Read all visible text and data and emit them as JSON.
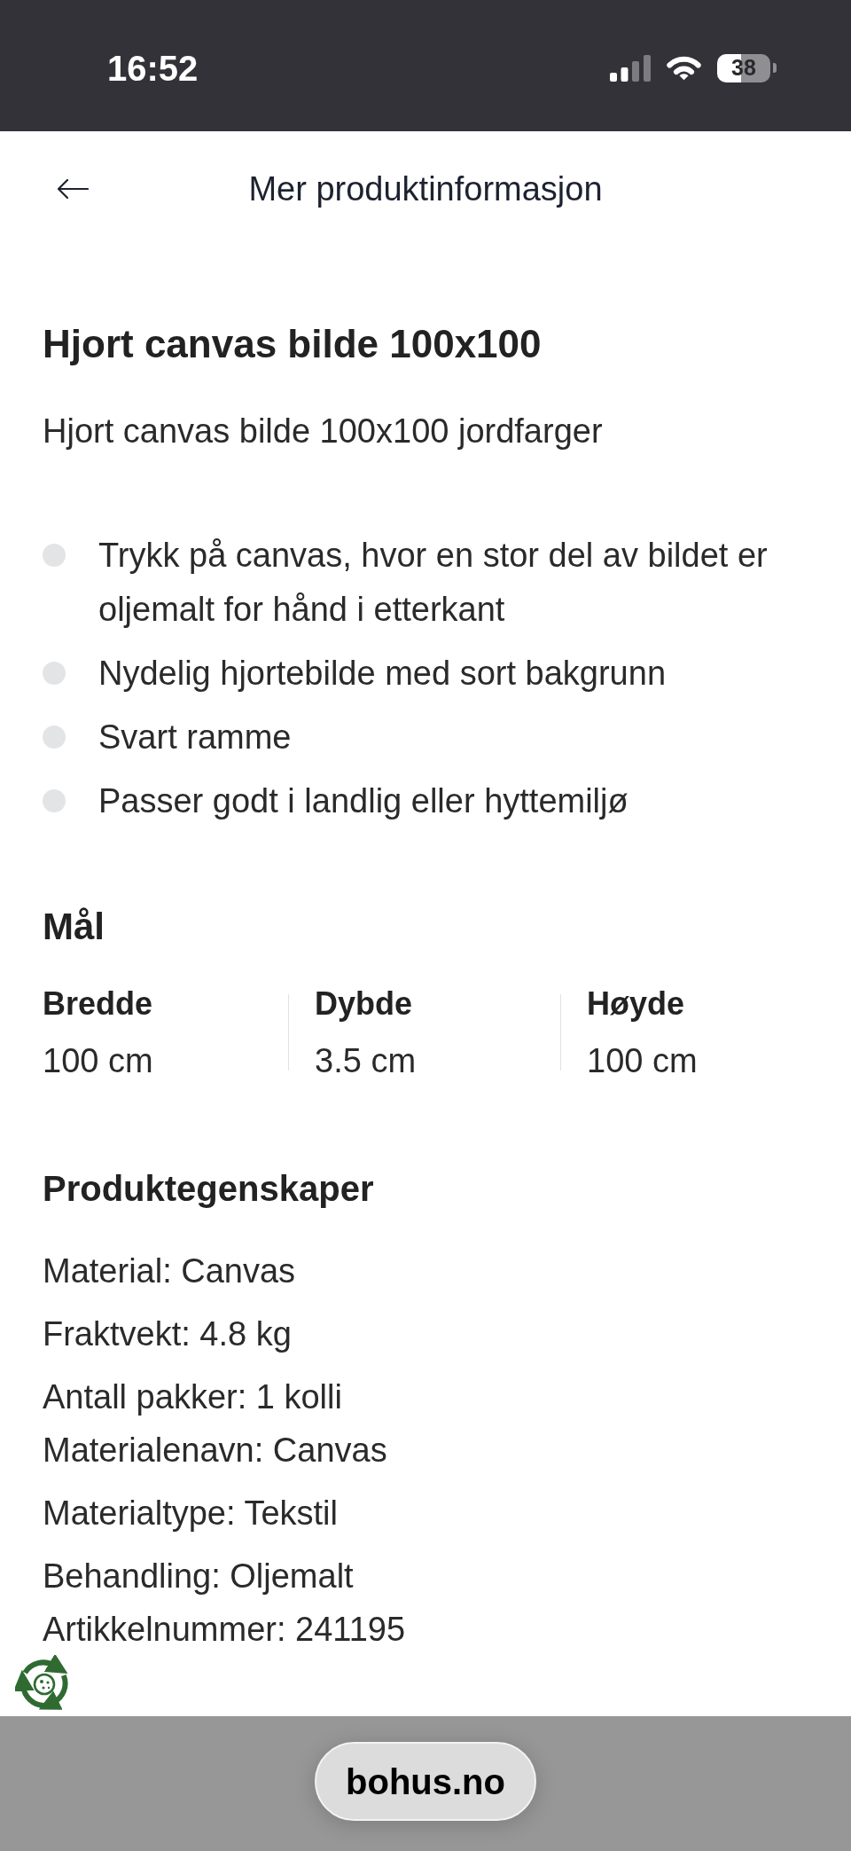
{
  "status_bar": {
    "time": "16:52",
    "battery": "38"
  },
  "header": {
    "title": "Mer produktinformasjon"
  },
  "product": {
    "title": "Hjort canvas bilde 100x100",
    "subtitle": "Hjort canvas bilde 100x100 jordfarger",
    "features": [
      "Trykk på canvas, hvor en stor del av bildet er oljemalt for hånd i etterkant",
      "Nydelig hjortebilde med sort bakgrunn",
      "Svart ramme",
      "Passer godt i landlig eller hyttemiljø"
    ]
  },
  "dimensions": {
    "heading": "Mål",
    "items": [
      {
        "label": "Bredde",
        "value": "100 cm"
      },
      {
        "label": "Dybde",
        "value": "3.5 cm"
      },
      {
        "label": "Høyde",
        "value": "100 cm"
      }
    ]
  },
  "properties": {
    "heading": "Produktegenskaper",
    "groups": [
      {
        "lines": [
          "Material: Canvas"
        ]
      },
      {
        "lines": [
          "Fraktvekt: 4.8 kg"
        ]
      },
      {
        "lines": [
          "Antall pakker: 1 kolli",
          "Materialenavn: Canvas"
        ]
      },
      {
        "lines": [
          "Materialtype: Tekstil"
        ]
      },
      {
        "lines": [
          "Behandling: Oljemalt",
          "Artikkelnummer: 241195"
        ]
      }
    ]
  },
  "browser_bar": {
    "url": "bohus.no"
  }
}
